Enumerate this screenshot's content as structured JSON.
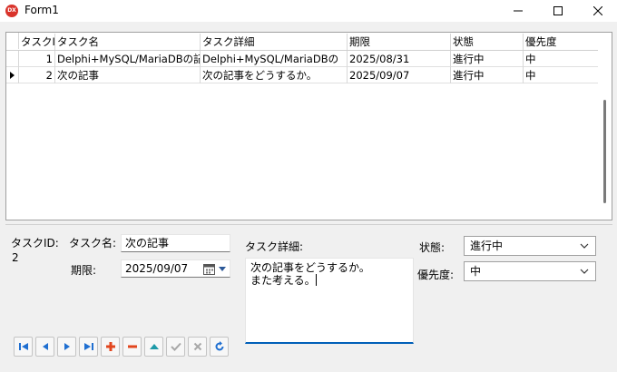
{
  "window": {
    "title": "Form1",
    "icon_text": "DX"
  },
  "grid": {
    "columns": [
      "タスクID",
      "タスク名",
      "タスク詳細",
      "期限",
      "状態",
      "優先度"
    ],
    "rows": [
      {
        "id": "1",
        "name": "Delphi+MySQL/MariaDBの記事作",
        "detail": "Delphi+MySQL/MariaDBの",
        "due": "2025/08/31",
        "status": "進行中",
        "priority": "中"
      },
      {
        "id": "2",
        "name": "次の記事",
        "detail": "次の記事をどうするか。",
        "due": "2025/09/07",
        "status": "進行中",
        "priority": "中"
      }
    ],
    "current_row": 2
  },
  "form": {
    "task_id_label": "タスクID:",
    "task_id_value": "2",
    "task_name_label": "タスク名:",
    "task_name_value": "次の記事",
    "due_label": "期限:",
    "due_value": "2025/09/07",
    "detail_label": "タスク詳細:",
    "detail_lines": [
      "次の記事をどうするか。",
      "また考える。"
    ],
    "status_label": "状態:",
    "status_value": "進行中",
    "priority_label": "優先度:",
    "priority_value": "中"
  },
  "navigator": {
    "buttons": [
      "first-icon",
      "prior-icon",
      "next-icon",
      "last-icon",
      "insert-icon",
      "delete-icon",
      "edit-icon",
      "post-icon",
      "cancel-icon",
      "refresh-icon"
    ]
  },
  "colors": {
    "accent": "#005fb8",
    "nav_blue": "#1f6fd1",
    "nav_red": "#e2461e",
    "nav_teal": "#1e9aa8",
    "disabled": "#a8a8a8"
  }
}
